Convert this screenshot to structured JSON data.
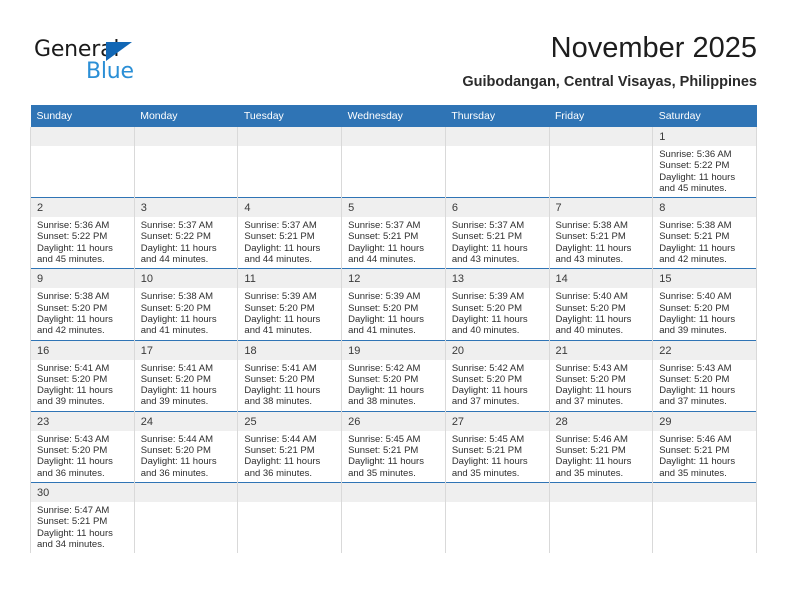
{
  "brand": {
    "name_primary": "General",
    "name_secondary": "Blue",
    "triangle_icon": "triangle-icon",
    "accent_color": "#1267b5",
    "secondary_color": "#2b8fd6"
  },
  "header": {
    "month_title": "November 2025",
    "location": "Guibodangan, Central Visayas, Philippines"
  },
  "theme": {
    "header_row_bg": "#2f74b5",
    "day_band_bg": "#efefef",
    "row_divider": "#2f74b5",
    "cell_divider": "#d9d9d9"
  },
  "calendar": {
    "weekday_headers": [
      "Sunday",
      "Monday",
      "Tuesday",
      "Wednesday",
      "Thursday",
      "Friday",
      "Saturday"
    ],
    "weeks": [
      [
        {
          "day": "",
          "empty": true,
          "sunrise": "",
          "sunset": "",
          "daylight1": "",
          "daylight2": ""
        },
        {
          "day": "",
          "empty": true,
          "sunrise": "",
          "sunset": "",
          "daylight1": "",
          "daylight2": ""
        },
        {
          "day": "",
          "empty": true,
          "sunrise": "",
          "sunset": "",
          "daylight1": "",
          "daylight2": ""
        },
        {
          "day": "",
          "empty": true,
          "sunrise": "",
          "sunset": "",
          "daylight1": "",
          "daylight2": ""
        },
        {
          "day": "",
          "empty": true,
          "sunrise": "",
          "sunset": "",
          "daylight1": "",
          "daylight2": ""
        },
        {
          "day": "",
          "empty": true,
          "sunrise": "",
          "sunset": "",
          "daylight1": "",
          "daylight2": ""
        },
        {
          "day": "1",
          "empty": false,
          "sunrise": "Sunrise: 5:36 AM",
          "sunset": "Sunset: 5:22 PM",
          "daylight1": "Daylight: 11 hours",
          "daylight2": "and 45 minutes."
        }
      ],
      [
        {
          "day": "2",
          "empty": false,
          "sunrise": "Sunrise: 5:36 AM",
          "sunset": "Sunset: 5:22 PM",
          "daylight1": "Daylight: 11 hours",
          "daylight2": "and 45 minutes."
        },
        {
          "day": "3",
          "empty": false,
          "sunrise": "Sunrise: 5:37 AM",
          "sunset": "Sunset: 5:22 PM",
          "daylight1": "Daylight: 11 hours",
          "daylight2": "and 44 minutes."
        },
        {
          "day": "4",
          "empty": false,
          "sunrise": "Sunrise: 5:37 AM",
          "sunset": "Sunset: 5:21 PM",
          "daylight1": "Daylight: 11 hours",
          "daylight2": "and 44 minutes."
        },
        {
          "day": "5",
          "empty": false,
          "sunrise": "Sunrise: 5:37 AM",
          "sunset": "Sunset: 5:21 PM",
          "daylight1": "Daylight: 11 hours",
          "daylight2": "and 44 minutes."
        },
        {
          "day": "6",
          "empty": false,
          "sunrise": "Sunrise: 5:37 AM",
          "sunset": "Sunset: 5:21 PM",
          "daylight1": "Daylight: 11 hours",
          "daylight2": "and 43 minutes."
        },
        {
          "day": "7",
          "empty": false,
          "sunrise": "Sunrise: 5:38 AM",
          "sunset": "Sunset: 5:21 PM",
          "daylight1": "Daylight: 11 hours",
          "daylight2": "and 43 minutes."
        },
        {
          "day": "8",
          "empty": false,
          "sunrise": "Sunrise: 5:38 AM",
          "sunset": "Sunset: 5:21 PM",
          "daylight1": "Daylight: 11 hours",
          "daylight2": "and 42 minutes."
        }
      ],
      [
        {
          "day": "9",
          "empty": false,
          "sunrise": "Sunrise: 5:38 AM",
          "sunset": "Sunset: 5:20 PM",
          "daylight1": "Daylight: 11 hours",
          "daylight2": "and 42 minutes."
        },
        {
          "day": "10",
          "empty": false,
          "sunrise": "Sunrise: 5:38 AM",
          "sunset": "Sunset: 5:20 PM",
          "daylight1": "Daylight: 11 hours",
          "daylight2": "and 41 minutes."
        },
        {
          "day": "11",
          "empty": false,
          "sunrise": "Sunrise: 5:39 AM",
          "sunset": "Sunset: 5:20 PM",
          "daylight1": "Daylight: 11 hours",
          "daylight2": "and 41 minutes."
        },
        {
          "day": "12",
          "empty": false,
          "sunrise": "Sunrise: 5:39 AM",
          "sunset": "Sunset: 5:20 PM",
          "daylight1": "Daylight: 11 hours",
          "daylight2": "and 41 minutes."
        },
        {
          "day": "13",
          "empty": false,
          "sunrise": "Sunrise: 5:39 AM",
          "sunset": "Sunset: 5:20 PM",
          "daylight1": "Daylight: 11 hours",
          "daylight2": "and 40 minutes."
        },
        {
          "day": "14",
          "empty": false,
          "sunrise": "Sunrise: 5:40 AM",
          "sunset": "Sunset: 5:20 PM",
          "daylight1": "Daylight: 11 hours",
          "daylight2": "and 40 minutes."
        },
        {
          "day": "15",
          "empty": false,
          "sunrise": "Sunrise: 5:40 AM",
          "sunset": "Sunset: 5:20 PM",
          "daylight1": "Daylight: 11 hours",
          "daylight2": "and 39 minutes."
        }
      ],
      [
        {
          "day": "16",
          "empty": false,
          "sunrise": "Sunrise: 5:41 AM",
          "sunset": "Sunset: 5:20 PM",
          "daylight1": "Daylight: 11 hours",
          "daylight2": "and 39 minutes."
        },
        {
          "day": "17",
          "empty": false,
          "sunrise": "Sunrise: 5:41 AM",
          "sunset": "Sunset: 5:20 PM",
          "daylight1": "Daylight: 11 hours",
          "daylight2": "and 39 minutes."
        },
        {
          "day": "18",
          "empty": false,
          "sunrise": "Sunrise: 5:41 AM",
          "sunset": "Sunset: 5:20 PM",
          "daylight1": "Daylight: 11 hours",
          "daylight2": "and 38 minutes."
        },
        {
          "day": "19",
          "empty": false,
          "sunrise": "Sunrise: 5:42 AM",
          "sunset": "Sunset: 5:20 PM",
          "daylight1": "Daylight: 11 hours",
          "daylight2": "and 38 minutes."
        },
        {
          "day": "20",
          "empty": false,
          "sunrise": "Sunrise: 5:42 AM",
          "sunset": "Sunset: 5:20 PM",
          "daylight1": "Daylight: 11 hours",
          "daylight2": "and 37 minutes."
        },
        {
          "day": "21",
          "empty": false,
          "sunrise": "Sunrise: 5:43 AM",
          "sunset": "Sunset: 5:20 PM",
          "daylight1": "Daylight: 11 hours",
          "daylight2": "and 37 minutes."
        },
        {
          "day": "22",
          "empty": false,
          "sunrise": "Sunrise: 5:43 AM",
          "sunset": "Sunset: 5:20 PM",
          "daylight1": "Daylight: 11 hours",
          "daylight2": "and 37 minutes."
        }
      ],
      [
        {
          "day": "23",
          "empty": false,
          "sunrise": "Sunrise: 5:43 AM",
          "sunset": "Sunset: 5:20 PM",
          "daylight1": "Daylight: 11 hours",
          "daylight2": "and 36 minutes."
        },
        {
          "day": "24",
          "empty": false,
          "sunrise": "Sunrise: 5:44 AM",
          "sunset": "Sunset: 5:20 PM",
          "daylight1": "Daylight: 11 hours",
          "daylight2": "and 36 minutes."
        },
        {
          "day": "25",
          "empty": false,
          "sunrise": "Sunrise: 5:44 AM",
          "sunset": "Sunset: 5:21 PM",
          "daylight1": "Daylight: 11 hours",
          "daylight2": "and 36 minutes."
        },
        {
          "day": "26",
          "empty": false,
          "sunrise": "Sunrise: 5:45 AM",
          "sunset": "Sunset: 5:21 PM",
          "daylight1": "Daylight: 11 hours",
          "daylight2": "and 35 minutes."
        },
        {
          "day": "27",
          "empty": false,
          "sunrise": "Sunrise: 5:45 AM",
          "sunset": "Sunset: 5:21 PM",
          "daylight1": "Daylight: 11 hours",
          "daylight2": "and 35 minutes."
        },
        {
          "day": "28",
          "empty": false,
          "sunrise": "Sunrise: 5:46 AM",
          "sunset": "Sunset: 5:21 PM",
          "daylight1": "Daylight: 11 hours",
          "daylight2": "and 35 minutes."
        },
        {
          "day": "29",
          "empty": false,
          "sunrise": "Sunrise: 5:46 AM",
          "sunset": "Sunset: 5:21 PM",
          "daylight1": "Daylight: 11 hours",
          "daylight2": "and 35 minutes."
        }
      ],
      [
        {
          "day": "30",
          "empty": false,
          "sunrise": "Sunrise: 5:47 AM",
          "sunset": "Sunset: 5:21 PM",
          "daylight1": "Daylight: 11 hours",
          "daylight2": "and 34 minutes."
        },
        {
          "day": "",
          "empty": true,
          "sunrise": "",
          "sunset": "",
          "daylight1": "",
          "daylight2": ""
        },
        {
          "day": "",
          "empty": true,
          "sunrise": "",
          "sunset": "",
          "daylight1": "",
          "daylight2": ""
        },
        {
          "day": "",
          "empty": true,
          "sunrise": "",
          "sunset": "",
          "daylight1": "",
          "daylight2": ""
        },
        {
          "day": "",
          "empty": true,
          "sunrise": "",
          "sunset": "",
          "daylight1": "",
          "daylight2": ""
        },
        {
          "day": "",
          "empty": true,
          "sunrise": "",
          "sunset": "",
          "daylight1": "",
          "daylight2": ""
        },
        {
          "day": "",
          "empty": true,
          "sunrise": "",
          "sunset": "",
          "daylight1": "",
          "daylight2": ""
        }
      ]
    ]
  }
}
